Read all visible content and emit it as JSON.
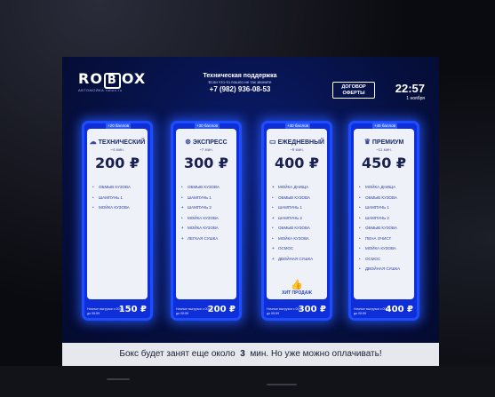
{
  "header": {
    "logo_letters": [
      "RO",
      "B",
      "OX"
    ],
    "logo_subtitle": "АВТОМОЙКА       robox.ru",
    "support_title": "Техническая поддержка",
    "support_note": "Если что-то пошло не так звоните",
    "support_phone": "+7 (982) 936-08-53",
    "offer_button": "ДОГОВОР ОФЕРТЫ",
    "time": "22:57",
    "date": "1 ноября"
  },
  "cards": [
    {
      "badge": "+20 баллов",
      "icon": "cloud-icon",
      "title": "ТЕХНИЧЕСКИЙ",
      "duration": "~4 мин.",
      "price": "200 ₽",
      "items": [
        {
          "mark": "•",
          "text": "ОБМЫВ КУЗОВА"
        },
        {
          "mark": "•",
          "text": "ШАМПУНЬ 1"
        },
        {
          "mark": "•",
          "text": "МОЙКА КУЗОВА"
        }
      ],
      "night_text": "Ночные выгрузки с 00:01 до 05:59",
      "night_price": "150 ₽"
    },
    {
      "badge": "+30 баллов",
      "icon": "steering-wheel-icon",
      "title": "ЭКСПРЕСС",
      "duration": "~7 мин.",
      "price": "300 ₽",
      "items": [
        {
          "mark": "•",
          "text": "ОБМЫВ КУЗОВА"
        },
        {
          "mark": "•",
          "text": "ШАМПУНЬ 1"
        },
        {
          "mark": "+",
          "text": "ШАМПУНЬ 2"
        },
        {
          "mark": "•",
          "text": "МОЙКА КУЗОВА"
        },
        {
          "mark": "+",
          "text": "МОЙКА КУЗОВА"
        },
        {
          "mark": "+",
          "text": "ЛЕГКАЯ СУШКА"
        }
      ],
      "night_text": "Ночные выгрузки с 00:01 до 05:59",
      "night_price": "200 ₽"
    },
    {
      "badge": "+40 баллов",
      "icon": "car-icon",
      "title": "ЕЖЕДНЕВНЫЙ",
      "duration": "~9 мин.",
      "price": "400 ₽",
      "items": [
        {
          "mark": "+",
          "text": "МОЙКА ДНИЩА"
        },
        {
          "mark": "•",
          "text": "ОБМЫВ КУЗОВА"
        },
        {
          "mark": "•",
          "text": "ШАМПУНЬ 1"
        },
        {
          "mark": "+",
          "text": "ШАМПУНЬ 2"
        },
        {
          "mark": "•",
          "text": "ОБМЫВ КУЗОВА"
        },
        {
          "mark": "•",
          "text": "МОЙКА КУЗОВА"
        },
        {
          "mark": "+",
          "text": "ОСМОС"
        },
        {
          "mark": "+",
          "text": "ДВОЙНАЯ СУШКА"
        }
      ],
      "hit_label": "ХИТ ПРОДАЖ",
      "night_text": "Ночные выгрузки с 00:01 до 05:59",
      "night_price": "300 ₽"
    },
    {
      "badge": "+45 баллов",
      "icon": "crown-icon",
      "title": "ПРЕМИУМ",
      "duration": "~11 мин.",
      "price": "450 ₽",
      "items": [
        {
          "mark": "•",
          "text": "МОЙКА ДНИЩА"
        },
        {
          "mark": "•",
          "text": "ОБМЫВ КУЗОВА"
        },
        {
          "mark": "•",
          "text": "ШАМПУНЬ 1"
        },
        {
          "mark": "•",
          "text": "ШАМПУНЬ 2"
        },
        {
          "mark": "•",
          "text": "ОБМЫВ КУЗОВА"
        },
        {
          "mark": "•",
          "text": "ПЕНА ОЧИСТ"
        },
        {
          "mark": "•",
          "text": "МОЙКА КУЗОВА"
        },
        {
          "mark": "•",
          "text": "ОСМОС"
        },
        {
          "mark": "•",
          "text": "ДВОЙНАЯ СУШКА"
        }
      ],
      "night_text": "Ночные выгрузки с 00:01 до 05:59",
      "night_price": "400 ₽"
    }
  ],
  "ticker": {
    "before": "Бокс будет занят еще около",
    "minutes": "3",
    "after": "мин. Но уже можно оплачивать!"
  },
  "colors": {
    "accent": "#1d4dff",
    "card_panel": "#eef1f8",
    "screen_bg": "#061040"
  }
}
